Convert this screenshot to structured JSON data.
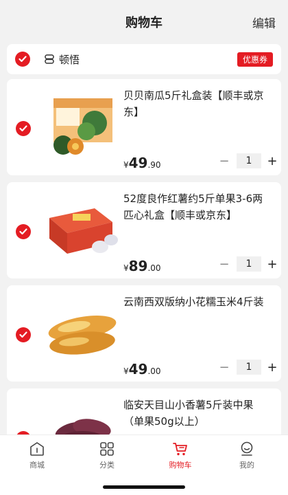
{
  "header": {
    "title": "购物车",
    "edit_label": "编辑"
  },
  "shop": {
    "name": "顿悟",
    "coupon_label": "优惠券",
    "checked": true
  },
  "items": [
    {
      "name": "贝贝南瓜5斤礼盒装【顺丰或京东】",
      "currency": "¥",
      "price_int": "49",
      "price_dec": ".90",
      "qty": "1",
      "checked": true,
      "image": "pumpkin-gift-box"
    },
    {
      "name": "52度良作红薯约5斤单果3-6两匹心礼盒【顺丰或京东】",
      "currency": "¥",
      "price_int": "89",
      "price_dec": ".00",
      "qty": "1",
      "checked": true,
      "image": "sweet-potato-gift-box"
    },
    {
      "name": "云南西双版纳小花糯玉米4斤装",
      "currency": "¥",
      "price_int": "49",
      "price_dec": ".00",
      "qty": "1",
      "checked": true,
      "image": "corn"
    },
    {
      "name": "临安天目山小香薯5斤装中果（单果50g以上）",
      "currency": "¥",
      "price_int": "",
      "price_dec": "",
      "qty": "",
      "checked": true,
      "image": "purple-sweet-potatoes"
    }
  ],
  "tabbar": {
    "tabs": [
      {
        "label": "商城",
        "icon": "store-icon"
      },
      {
        "label": "分类",
        "icon": "category-icon"
      },
      {
        "label": "购物车",
        "icon": "cart-icon",
        "active": true
      },
      {
        "label": "我的",
        "icon": "profile-icon"
      }
    ]
  },
  "colors": {
    "accent": "#e41c23",
    "background": "#f2f2f2",
    "card": "#ffffff"
  }
}
